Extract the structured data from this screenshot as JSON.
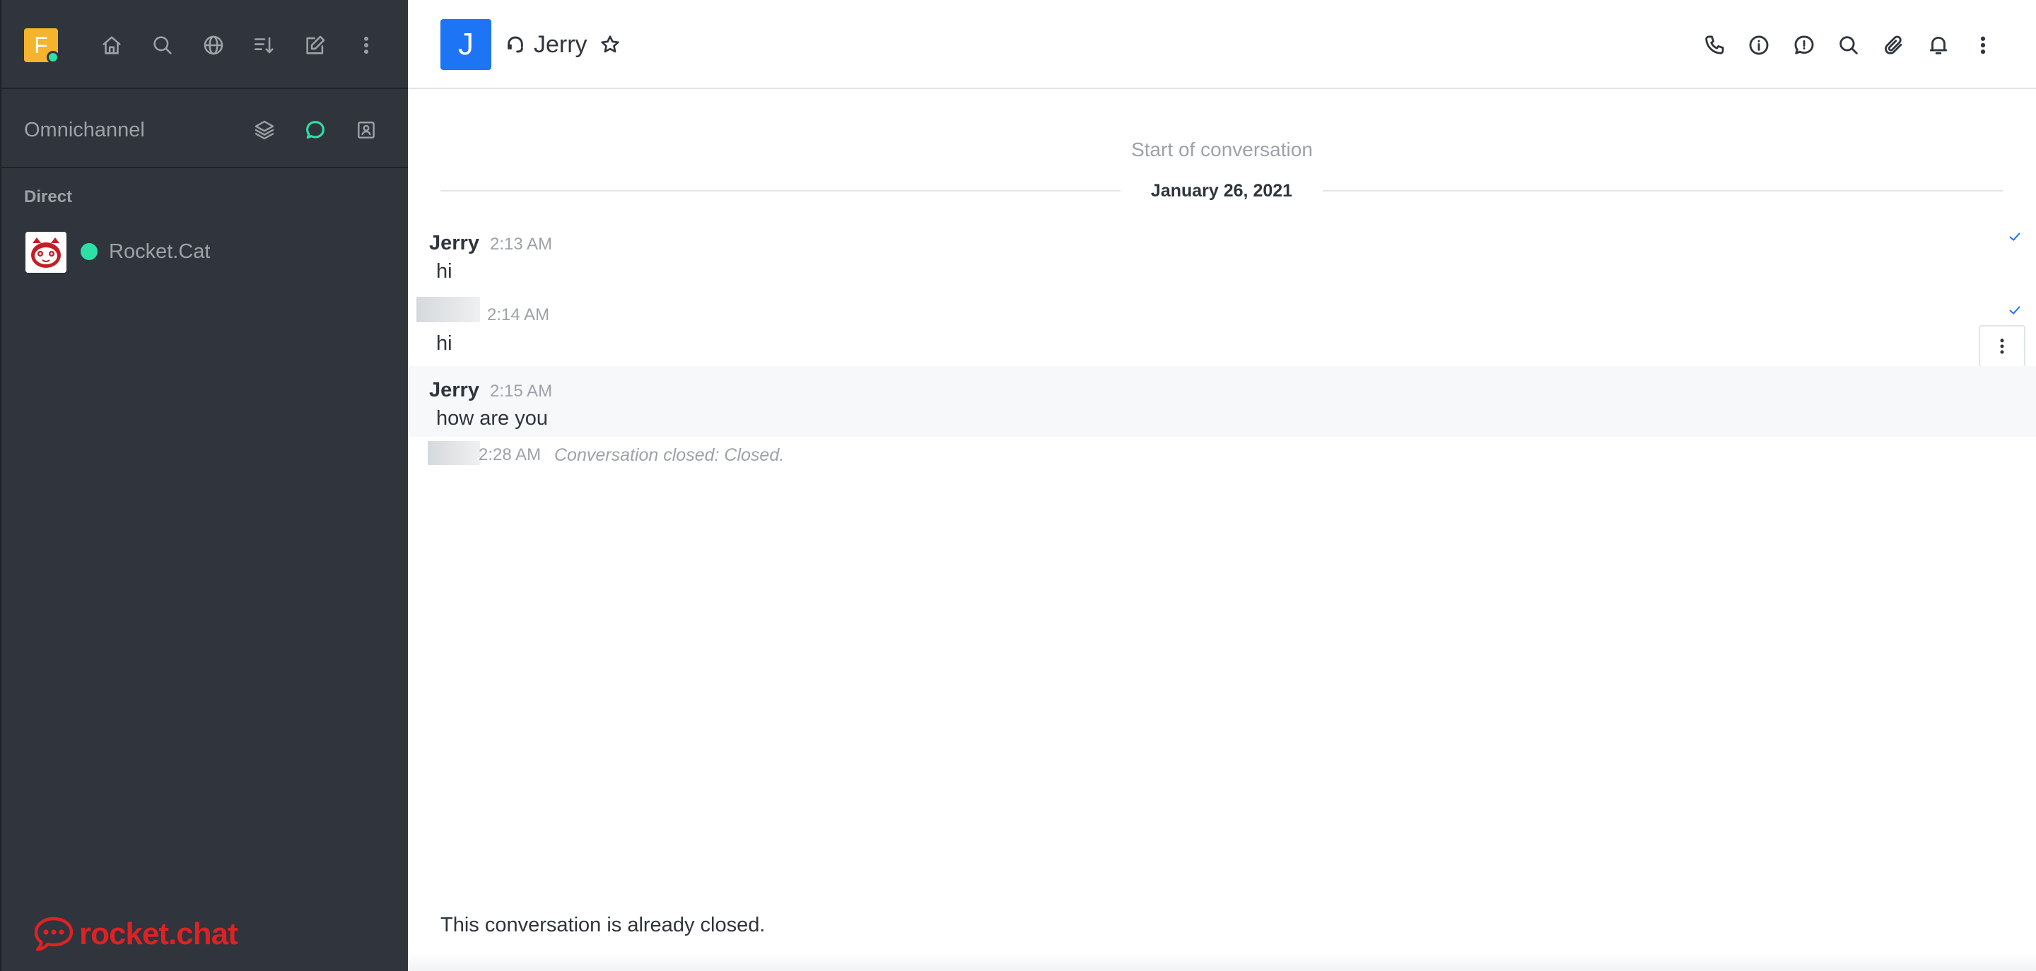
{
  "sidebar": {
    "user_initial": "F",
    "omnichannel_title": "Omnichannel",
    "section_title": "Direct",
    "rooms": [
      {
        "name": "Rocket.Cat",
        "status": "online"
      }
    ],
    "brand_text": "rocket.chat"
  },
  "header": {
    "avatar_initial": "J",
    "title": "Jerry"
  },
  "conversation": {
    "start_label": "Start of conversation",
    "date": "January 26, 2021",
    "messages": [
      {
        "user": "Jerry",
        "time": "2:13 AM",
        "text": "hi"
      },
      {
        "user": "",
        "time": "2:14 AM",
        "text": "hi"
      },
      {
        "user": "Jerry",
        "time": "2:15 AM",
        "text": "how are you"
      }
    ],
    "system_message": {
      "time": "2:28 AM",
      "text": "Conversation closed: Closed."
    }
  },
  "footer": {
    "notice": "This conversation is already closed."
  },
  "colors": {
    "sidebar_bg": "#2f343d",
    "accent_green": "#2de0a5",
    "avatar_blue": "#1d74f5",
    "user_avatar_yellow": "#f5b42c",
    "brand_red": "#db2323"
  },
  "icons": {
    "sidebar_toolbar": [
      "home-icon",
      "search-icon",
      "globe-icon",
      "sort-icon",
      "edit-icon",
      "kebab-icon"
    ],
    "omnichannel": [
      "layers-icon",
      "chat-icon",
      "contact-icon"
    ],
    "header_toolbar": [
      "phone-icon",
      "info-icon",
      "alert-icon",
      "search-icon",
      "attachment-icon",
      "bell-icon",
      "kebab-icon"
    ]
  }
}
